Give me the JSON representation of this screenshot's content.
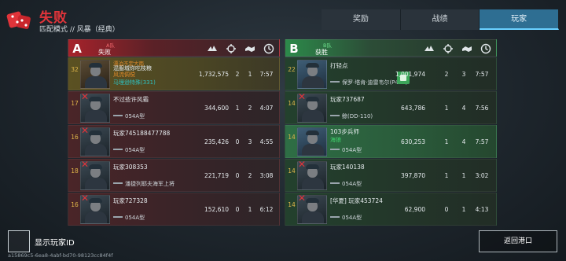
{
  "header": {
    "result_title": "失败",
    "subtitle": "匹配模式 // 风暴（经典）"
  },
  "tabs": [
    {
      "label": "奖励",
      "active": false
    },
    {
      "label": "战绩",
      "active": false
    },
    {
      "label": "玩家",
      "active": true
    }
  ],
  "column_icons": [
    "damage-icon",
    "kills-icon",
    "assists-icon",
    "time-icon"
  ],
  "team_a": {
    "letter": "A",
    "tag": "A队",
    "result": "失败",
    "players": [
      {
        "level": "32",
        "name": "漂泊不定大雨",
        "line2": "混服城你吃枝粮",
        "line3": "风流倜傥",
        "pc": "马理逊特殊(331)",
        "ship": "",
        "score": "1,732,575",
        "kills": "2",
        "assists": "1",
        "time": "7:57",
        "dead": false,
        "highlight": true
      },
      {
        "level": "17",
        "name": "不过些许风霜",
        "ship": "054A型",
        "score": "344,600",
        "kills": "1",
        "assists": "2",
        "time": "4:07",
        "dead": true
      },
      {
        "level": "16",
        "name": "玩家745188477788",
        "ship": "054A型",
        "score": "235,426",
        "kills": "0",
        "assists": "3",
        "time": "4:55",
        "dead": true
      },
      {
        "level": "18",
        "name": "玩家308353",
        "ship": "潘捷列耶夫海军上将",
        "score": "221,719",
        "kills": "0",
        "assists": "2",
        "time": "3:08",
        "dead": true
      },
      {
        "level": "16",
        "name": "玩家727328",
        "ship": "054A型",
        "score": "152,610",
        "kills": "0",
        "assists": "1",
        "time": "6:12",
        "dead": true
      }
    ]
  },
  "team_b": {
    "letter": "B",
    "tag": "B队",
    "result": "获胜",
    "players": [
      {
        "level": "22",
        "name": "打轻点",
        "ship": "保罗·塔肯·迪雷韦尔(P430)",
        "score": "1,001,974",
        "kills": "2",
        "assists": "3",
        "time": "7:57",
        "dead": false,
        "highlight": false,
        "liked": true
      },
      {
        "level": "14",
        "name": "玩家737687",
        "ship": "鲸(DD-110)",
        "score": "643,786",
        "kills": "1",
        "assists": "4",
        "time": "7:56",
        "dead": true
      },
      {
        "level": "14",
        "name": "103步兵师",
        "line2": "海狼",
        "ship": "054A型",
        "score": "630,253",
        "kills": "1",
        "assists": "4",
        "time": "7:57",
        "dead": false,
        "highlight": true
      },
      {
        "level": "14",
        "name": "玩家140138",
        "ship": "054A型",
        "score": "397,870",
        "kills": "1",
        "assists": "1",
        "time": "3:02",
        "dead": true
      },
      {
        "level": "14",
        "name": "[华夏] 玩家453724",
        "ship": "054A型",
        "score": "62,900",
        "kills": "0",
        "assists": "1",
        "time": "4:13",
        "dead": true
      }
    ]
  },
  "footer": {
    "checkbox_label": "显示玩家ID",
    "return_button": "返回港口",
    "match_id": "a15869c5-6ea8-4abf-bd70-98123cc84f4f"
  },
  "colors": {
    "defeat_red": "#e0343a",
    "team_a": "#a7232b",
    "team_b": "#2c8a4a",
    "tab_active": "#2e6e92"
  }
}
